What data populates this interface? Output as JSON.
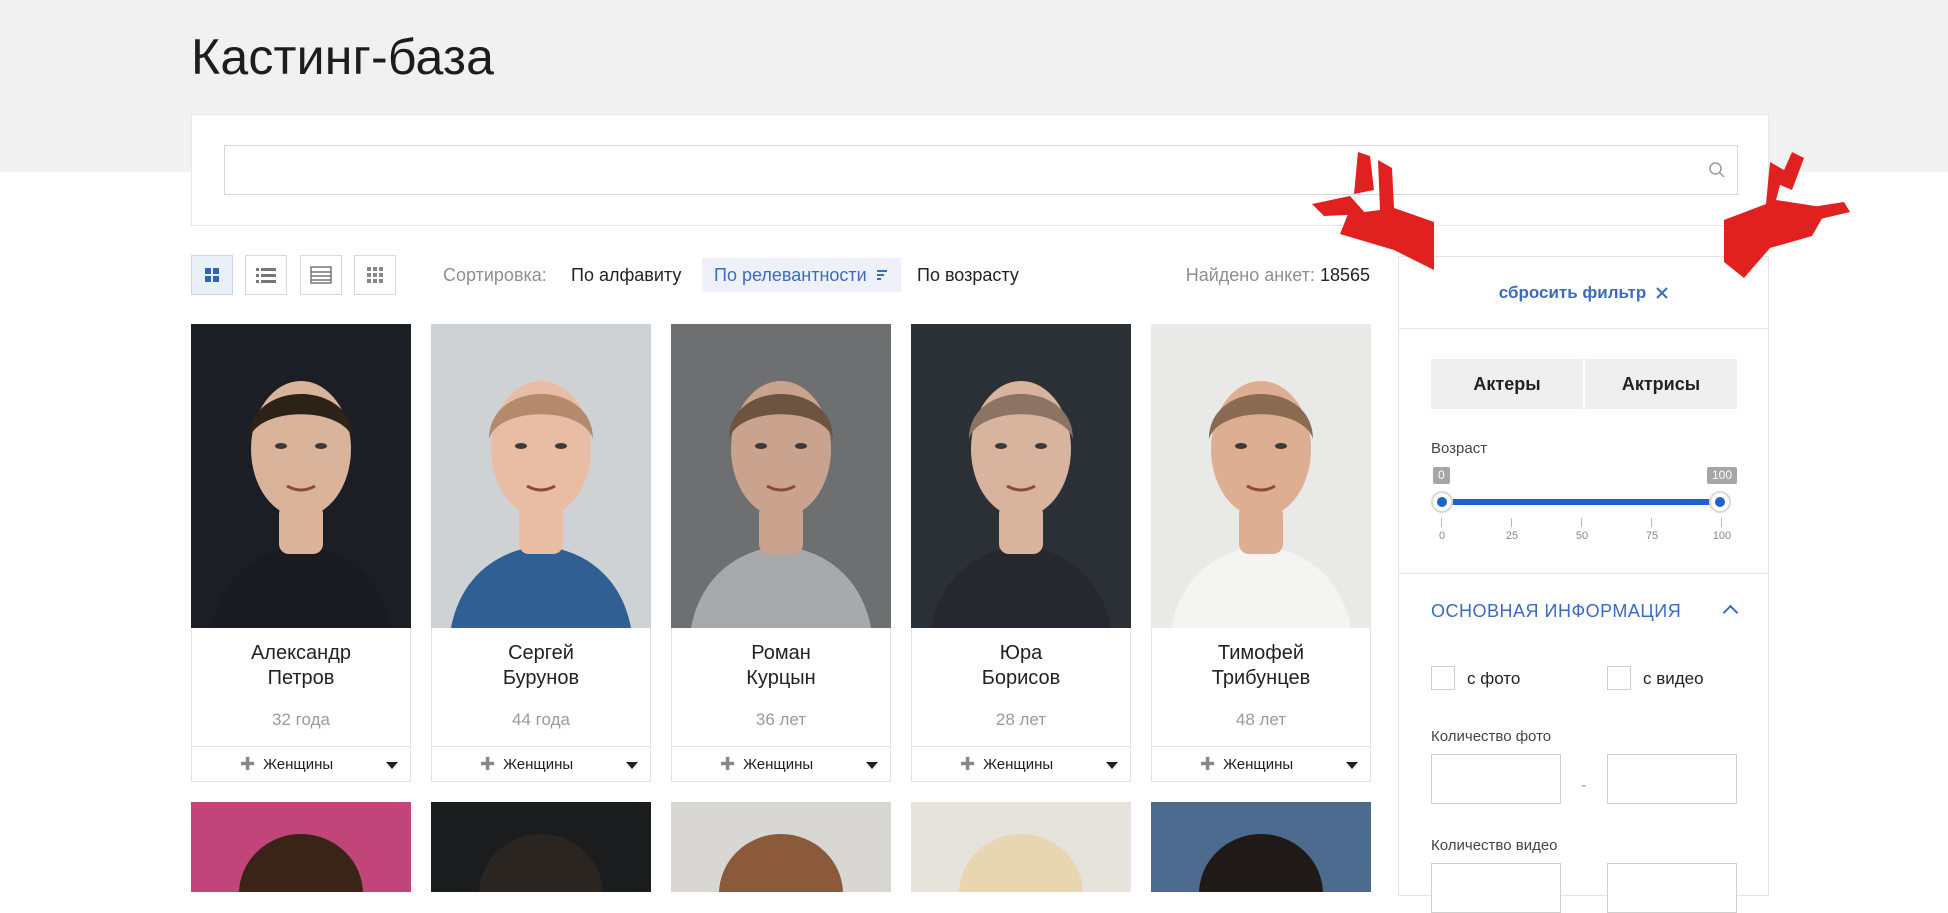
{
  "page": {
    "title": "Кастинг-база"
  },
  "search": {
    "placeholder": ""
  },
  "toolbar": {
    "views": [
      "grid-large",
      "list",
      "table",
      "grid-small"
    ],
    "sort_label": "Сортировка:",
    "sort_options": [
      "По алфавиту",
      "По релевантности",
      "По возрасту"
    ],
    "sort_active": "По релевантности",
    "found_label": "Найдено анкет:",
    "found_count": "18565"
  },
  "actors": [
    {
      "first": "Александр",
      "last": "Петров",
      "age": "32 года",
      "group": "Женщины",
      "bg": "#1b1e24",
      "skin": "#d9b39a",
      "hair": "#2c2218",
      "shirt": "#1a1b20"
    },
    {
      "first": "Сергей",
      "last": "Бурунов",
      "age": "44 года",
      "group": "Женщины",
      "bg": "#cfd2d4",
      "skin": "#e9bda3",
      "hair": "#b38a6b",
      "shirt": "#2f5f93"
    },
    {
      "first": "Роман",
      "last": "Курцын",
      "age": "36 лет",
      "group": "Женщины",
      "bg": "#6e6f71",
      "skin": "#c9a38d",
      "hair": "#6d5440",
      "shirt": "#a8a9ab"
    },
    {
      "first": "Юра",
      "last": "Борисов",
      "age": "28 лет",
      "group": "Женщины",
      "bg": "#2a3036",
      "skin": "#d8b49f",
      "hair": "#8b7463",
      "shirt": "#25292e"
    },
    {
      "first": "Тимофей",
      "last": "Трибунцев",
      "age": "48 лет",
      "group": "Женщины",
      "bg": "#e9e9e7",
      "skin": "#deae93",
      "hair": "#8a6a50",
      "shirt": "#f4f4f2"
    }
  ],
  "next_row": [
    {
      "bg": "#c2457a",
      "hair": "#3a2418"
    },
    {
      "bg": "#1a1c1e",
      "hair": "#2a2520"
    },
    {
      "bg": "#d9d7d3",
      "hair": "#8a5a3a"
    },
    {
      "bg": "#e6e2dc",
      "hair": "#e8d6b0"
    },
    {
      "bg": "#4d6b8f",
      "hair": "#1f1a17"
    }
  ],
  "filter": {
    "reset_label": "сбросить фильтр",
    "gender": [
      "Актеры",
      "Актрисы"
    ],
    "age_label": "Возраст",
    "age_min": "0",
    "age_max": "100",
    "age_ticks": [
      "0",
      "25",
      "50",
      "75",
      "100"
    ],
    "section_title": "ОСНОВНАЯ ИНФОРМАЦИЯ",
    "with_photo": "с фото",
    "with_video": "с видео",
    "photo_count_label": "Количество фото",
    "video_count_label": "Количество видео",
    "range_dash": "-"
  },
  "colors": {
    "accent": "#3a6bc1",
    "slider": "#1d64c9",
    "arrow": "#e0211f"
  }
}
